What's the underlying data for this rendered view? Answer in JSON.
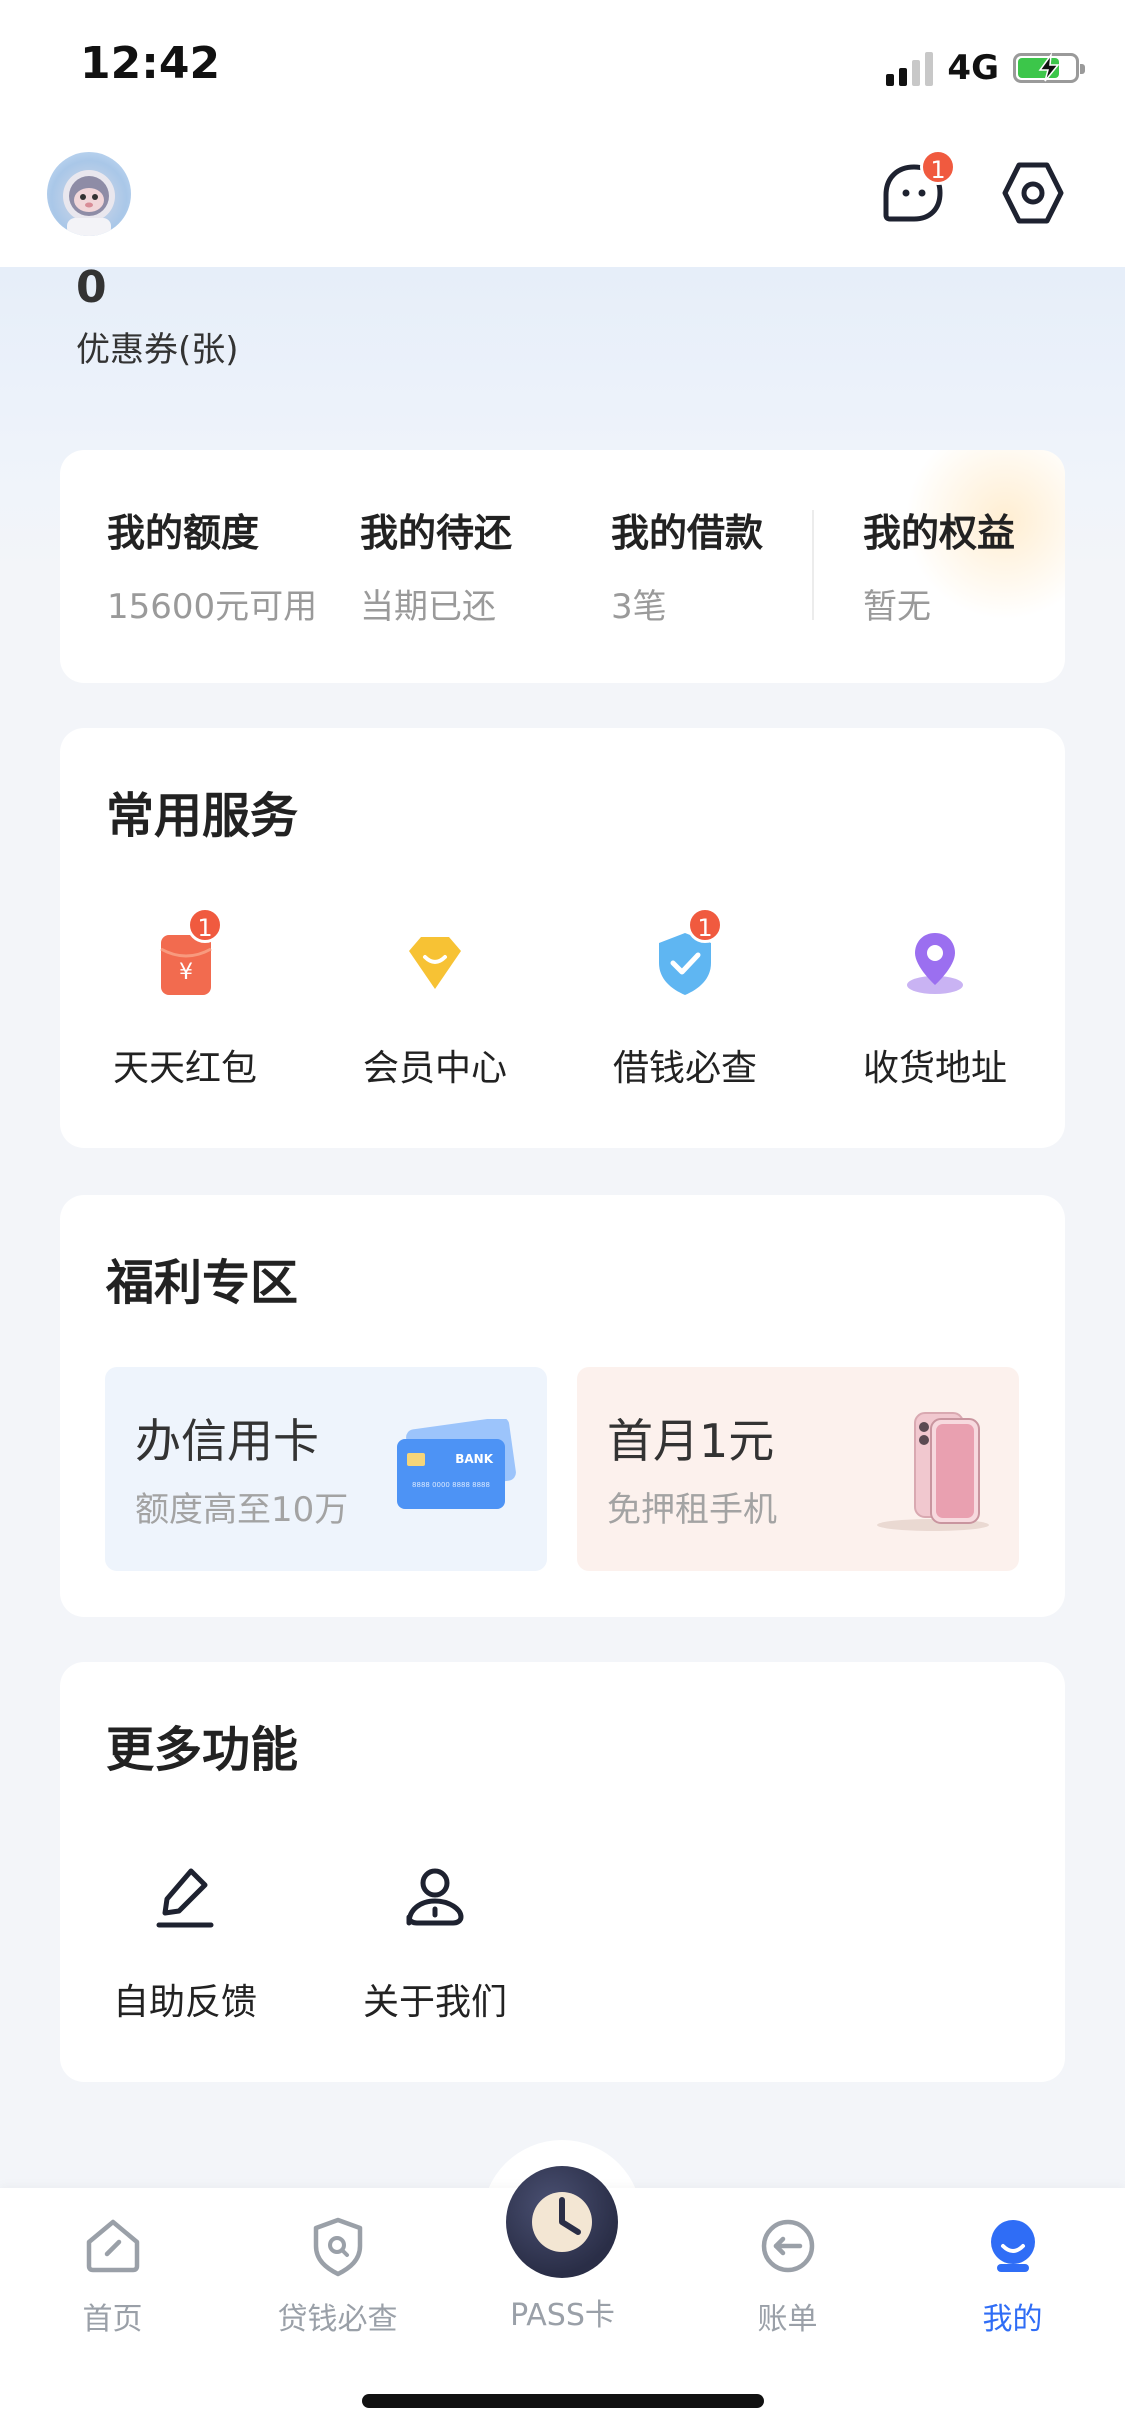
{
  "status_bar": {
    "time": "12:42",
    "network": "4G",
    "battery_level": 0.75,
    "battery_color": "#3cc64a"
  },
  "header": {
    "avatar_icon": "astronaut-avatar",
    "message_icon": "chat-bubble-icon",
    "message_badge": "1",
    "settings_icon": "hexagon-settings-icon"
  },
  "coupons": {
    "count": "0",
    "label": "优惠券(张)"
  },
  "account": {
    "items": [
      {
        "title": "我的额度",
        "sub": "15600元可用"
      },
      {
        "title": "我的待还",
        "sub": "当期已还"
      },
      {
        "title": "我的借款",
        "sub": "3笔"
      },
      {
        "title": "我的权益",
        "sub": "暂无"
      }
    ]
  },
  "services": {
    "title": "常用服务",
    "items": [
      {
        "label": "天天红包",
        "icon": "red-envelope-icon",
        "badge": "1"
      },
      {
        "label": "会员中心",
        "icon": "vip-diamond-icon",
        "badge": ""
      },
      {
        "label": "借钱必查",
        "icon": "shield-check-icon",
        "badge": "1"
      },
      {
        "label": "收货地址",
        "icon": "location-pin-icon",
        "badge": ""
      }
    ]
  },
  "welfare": {
    "title": "福利专区",
    "items": [
      {
        "title": "办信用卡",
        "sub": "额度高至10万",
        "icon": "bank-card-icon",
        "card_text": "BANK",
        "card_number": "8888 0000 8888 8888"
      },
      {
        "title": "首月1元",
        "sub": "免押租手机",
        "icon": "smartphone-icon"
      }
    ]
  },
  "more": {
    "title": "更多功能",
    "items": [
      {
        "label": "自助反馈",
        "icon": "edit-pen-icon"
      },
      {
        "label": "关于我们",
        "icon": "about-person-icon"
      }
    ]
  },
  "tabbar": {
    "active_color": "#2f6df6",
    "items": [
      {
        "label": "首页",
        "icon": "home-icon"
      },
      {
        "label": "贷钱必查",
        "icon": "shield-search-icon"
      },
      {
        "label": "PASS卡",
        "icon": "pass-card-icon"
      },
      {
        "label": "账单",
        "icon": "bill-back-icon"
      },
      {
        "label": "我的",
        "icon": "profile-icon"
      }
    ],
    "active_index": 4
  }
}
